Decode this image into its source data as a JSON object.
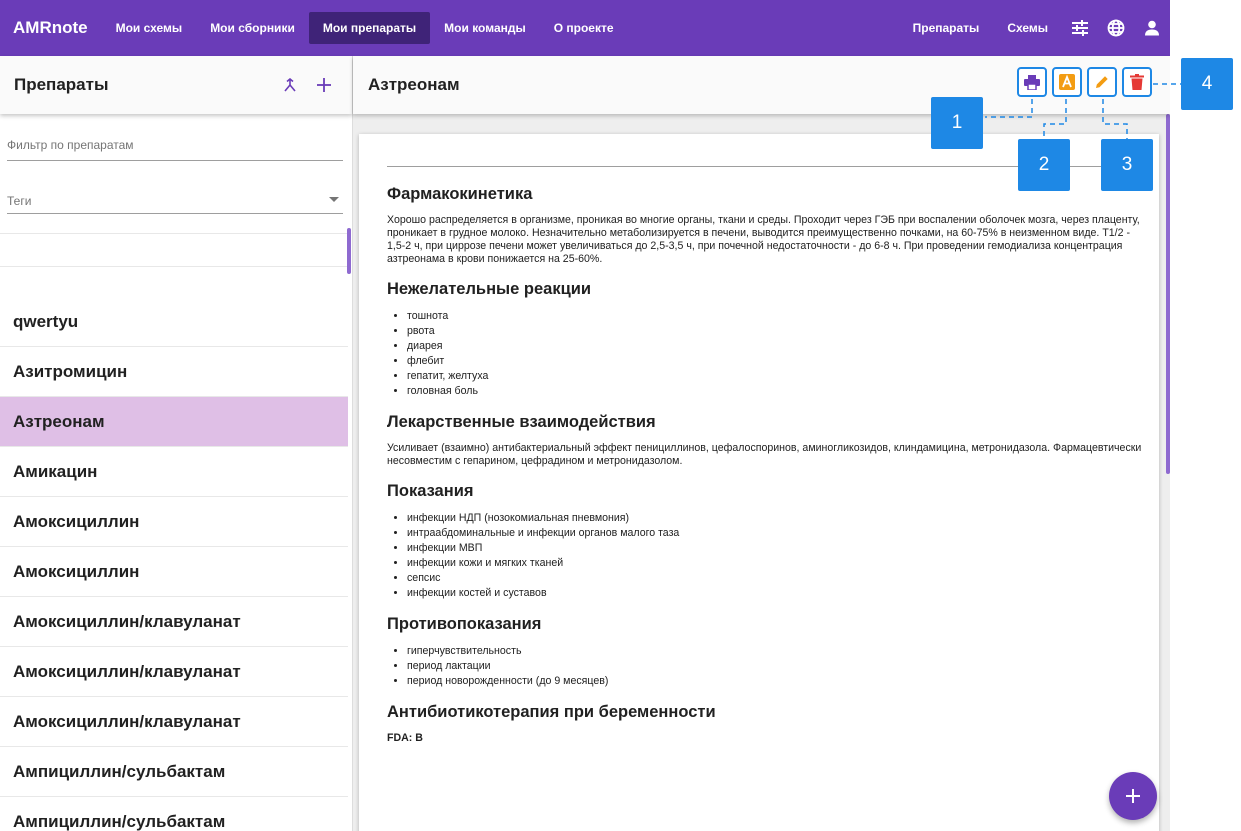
{
  "topbar": {
    "brand": "AMRnote",
    "nav": [
      "Мои схемы",
      "Мои сборники",
      "Мои препараты",
      "Мои команды",
      "О проекте"
    ],
    "right": [
      "Препараты",
      "Схемы"
    ],
    "icons": [
      "tune-icon",
      "globe-icon",
      "user-icon"
    ]
  },
  "left": {
    "title": "Препараты",
    "filter_placeholder": "Фильтр по препаратам",
    "tags_label": "Теги",
    "items": [
      "qwertyu",
      "Азитромицин",
      "Азтреонам",
      "Амикацин",
      "Амоксициллин",
      "Амоксициллин",
      "Амоксициллин/клавуланат",
      "Амоксициллин/клавуланат",
      "Амоксициллин/клавуланат",
      "Ампициллин/сульбактам",
      "Ампициллин/сульбактам"
    ],
    "selected_index": 2
  },
  "main": {
    "title": "Азтреонам",
    "sections": {
      "pk_title": "Фармакокинетика",
      "pk_text": "Хорошо распределяется в организме, проникая во многие органы, ткани и среды. Проходит через ГЭБ при воспалении оболочек мозга, через плаценту, проникает в грудное молоко. Незначительно метаболизируется в печени, выводится преимущественно почками, на 60-75% в неизменном виде. T1/2 - 1,5-2 ч, при циррозе печени может увеличиваться до 2,5-3,5 ч, при почечной недостаточности - до 6-8 ч. При проведении гемодиализа концентрация азтреонама в крови понижается на 25-60%.",
      "ae_title": "Нежелательные реакции",
      "ae_items": [
        "тошнота",
        "рвота",
        "диарея",
        "флебит",
        "гепатит, желтуха",
        "головная боль"
      ],
      "int_title": "Лекарственные взаимодействия",
      "int_text": "Усиливает (взаимно) антибактериальный эффект пенициллинов, цефалоспоринов, аминогликозидов, клиндамицина, метронидазола. Фармацевтически несовместим с гепарином, цефрадином и метронидазолом.",
      "ind_title": "Показания",
      "ind_items": [
        "инфекции НДП (нозокомиальная пневмония)",
        "интраабдоминальные и инфекции органов малого таза",
        "инфекции МВП",
        "инфекции кожи и мягких тканей",
        "сепсис",
        "инфекции костей и суставов"
      ],
      "contra_title": "Противопоказания",
      "contra_items": [
        "гиперчувствительность",
        "период лактации",
        "период новорожденности (до 9 месяцев)"
      ],
      "preg_title": "Антибиотикотерапия при беременности",
      "fda_label": "FDA: B"
    }
  },
  "callouts": [
    "1",
    "2",
    "3",
    "4"
  ],
  "colors": {
    "primary": "#6a3cb8",
    "nav_active": "#3f2378",
    "selected": "#dfbfe6",
    "callout": "#1e88e5"
  }
}
